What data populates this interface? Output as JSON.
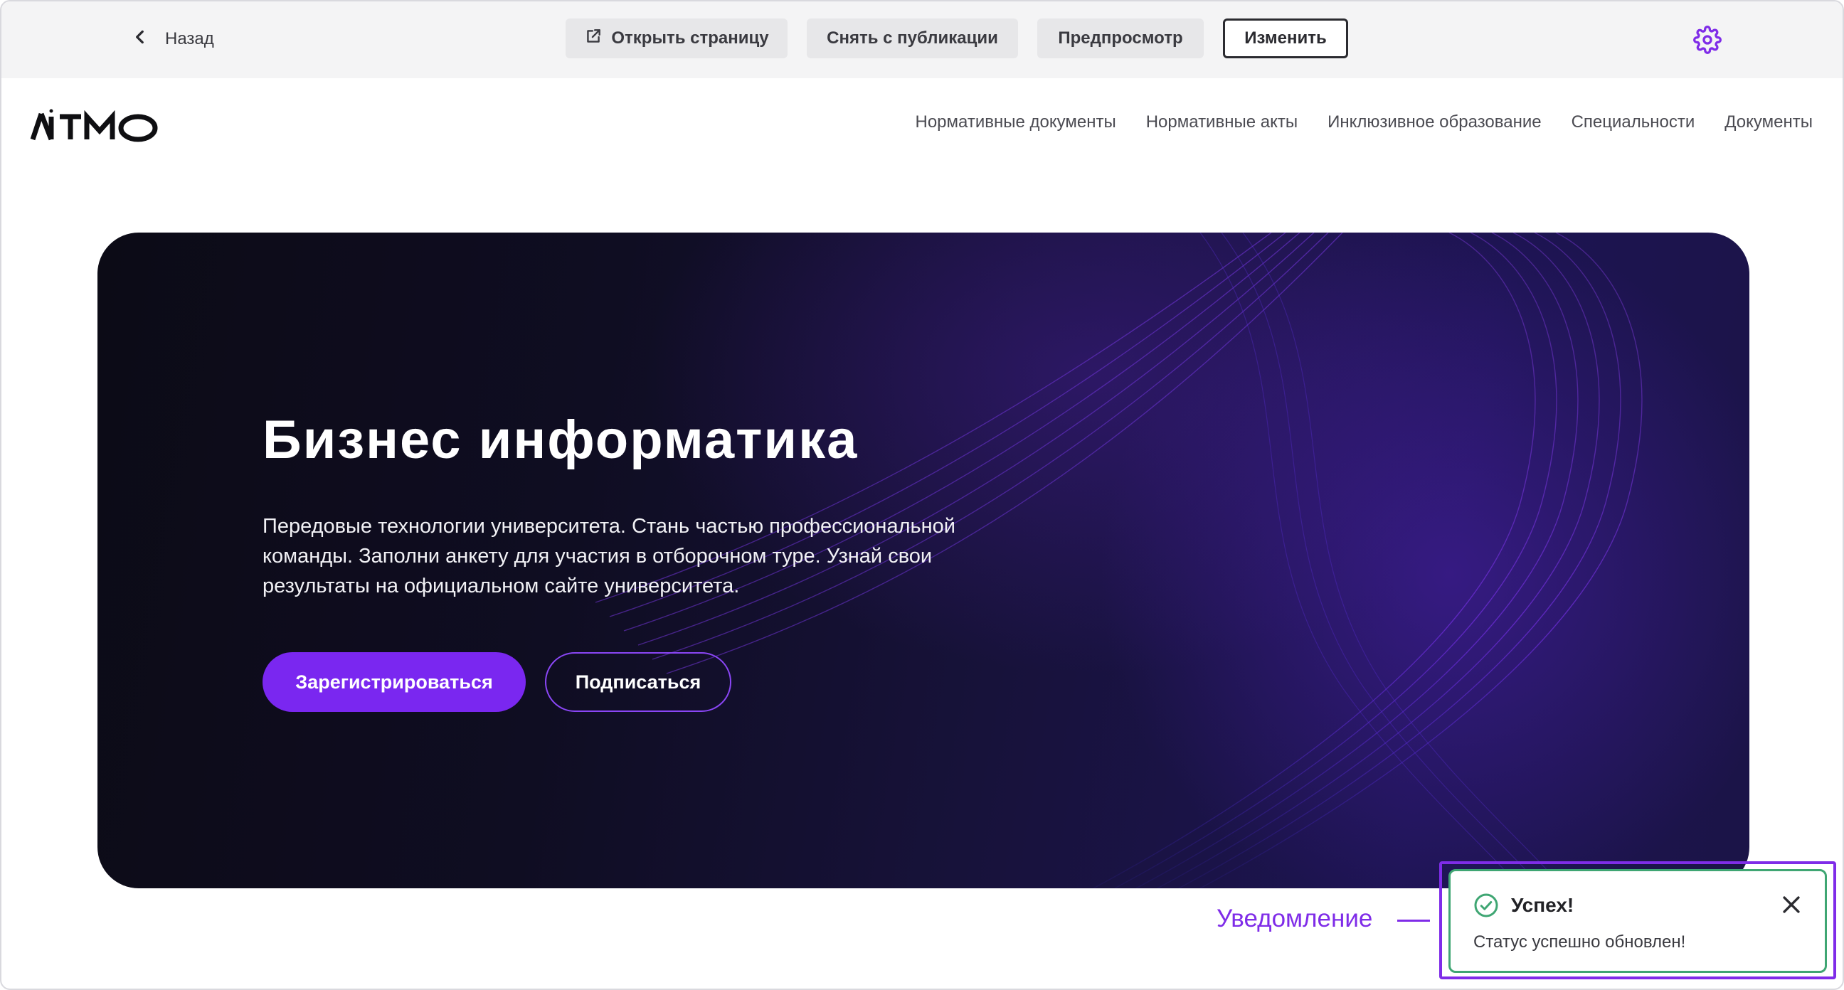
{
  "toolbar": {
    "back_label": "Назад",
    "open_page_label": "Открыть страницу",
    "unpublish_label": "Снять с публикации",
    "preview_label": "Предпросмотр",
    "edit_label": "Изменить"
  },
  "header": {
    "logo_text": "ИТМО",
    "nav": [
      "Нормативные документы",
      "Нормативные акты",
      "Инклюзивное образование",
      "Специальности",
      "Документы"
    ]
  },
  "hero": {
    "title": "Бизнес информатика",
    "description": "Передовые технологии университета. Стань частью профессиональной команды. Заполни анкету для участия в отборочном туре. Узнай свои результаты на официальном сайте университета.",
    "register_label": "Зарегистрироваться",
    "subscribe_label": "Подписаться"
  },
  "annotation": {
    "label": "Уведомление"
  },
  "toast": {
    "title": "Успех!",
    "message": "Статус успешно обновлен!"
  },
  "colors": {
    "accent": "#7a27f0",
    "success": "#3fa673",
    "annotation": "#7f2ce8"
  },
  "icons": {
    "back": "chevron-left-icon",
    "open_page": "external-link-icon",
    "settings": "gear-icon",
    "toast_status": "check-circle-icon",
    "toast_close": "close-icon"
  }
}
